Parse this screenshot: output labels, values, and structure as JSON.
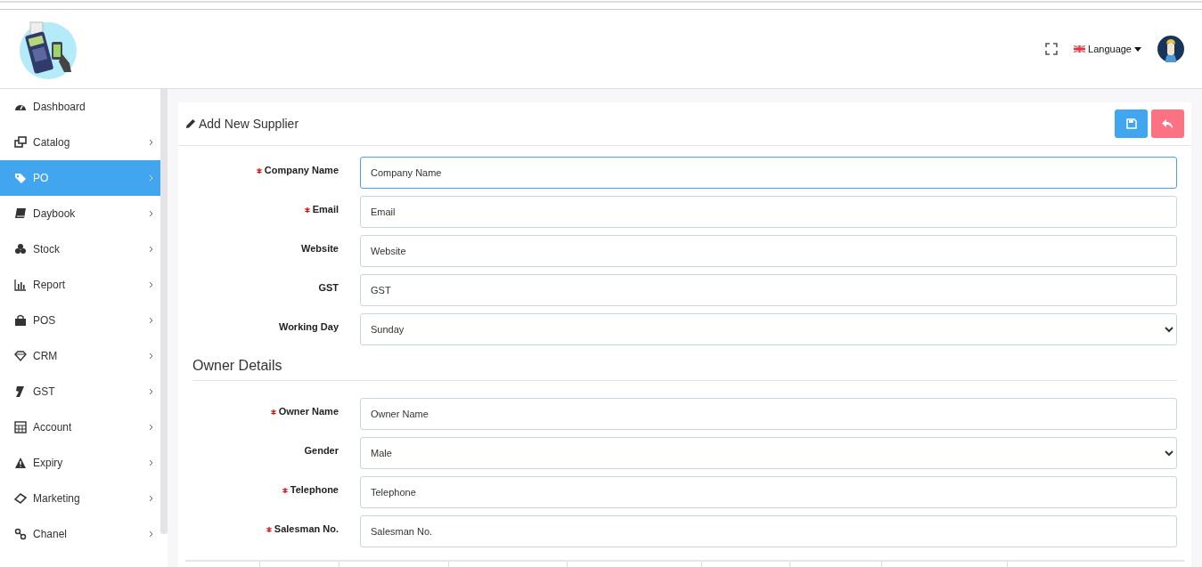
{
  "header": {
    "language": "Language"
  },
  "sidebar": {
    "items": [
      {
        "label": "Dashboard",
        "has_submenu": false,
        "selected": false
      },
      {
        "label": "Catalog",
        "has_submenu": true,
        "selected": false
      },
      {
        "label": "PO",
        "has_submenu": true,
        "selected": true
      },
      {
        "label": "Daybook",
        "has_submenu": true,
        "selected": false
      },
      {
        "label": "Stock",
        "has_submenu": true,
        "selected": false
      },
      {
        "label": "Report",
        "has_submenu": true,
        "selected": false
      },
      {
        "label": "POS",
        "has_submenu": true,
        "selected": false
      },
      {
        "label": "CRM",
        "has_submenu": true,
        "selected": false
      },
      {
        "label": "GST",
        "has_submenu": true,
        "selected": false
      },
      {
        "label": "Account",
        "has_submenu": true,
        "selected": false
      },
      {
        "label": "Expiry",
        "has_submenu": true,
        "selected": false
      },
      {
        "label": "Marketing",
        "has_submenu": true,
        "selected": false
      },
      {
        "label": "Chanel",
        "has_submenu": true,
        "selected": false
      }
    ]
  },
  "card": {
    "title": "Add New Supplier",
    "sections": [
      {
        "fields": [
          {
            "label": "Company Name",
            "required": true,
            "kind": "text",
            "placeholder": "Company Name",
            "focused": true
          },
          {
            "label": "Email",
            "required": true,
            "kind": "text",
            "placeholder": "Email",
            "focused": false
          },
          {
            "label": "Website",
            "required": false,
            "kind": "text",
            "placeholder": "Website",
            "focused": false
          },
          {
            "label": "GST",
            "required": false,
            "kind": "text",
            "placeholder": "GST",
            "focused": false
          },
          {
            "label": "Working Day",
            "required": false,
            "kind": "select",
            "value": "Sunday",
            "focused": false
          }
        ]
      },
      {
        "heading": "Owner Details",
        "fields": [
          {
            "label": "Owner Name",
            "required": true,
            "kind": "text",
            "placeholder": "Owner Name",
            "focused": false
          },
          {
            "label": "Gender",
            "required": false,
            "kind": "select",
            "value": "Male",
            "focused": false
          },
          {
            "label": "Telephone",
            "required": true,
            "kind": "text",
            "placeholder": "Telephone",
            "focused": false
          },
          {
            "label": "Salesman No.",
            "required": true,
            "kind": "text",
            "placeholder": "Salesman No.",
            "focused": false
          }
        ]
      }
    ]
  }
}
